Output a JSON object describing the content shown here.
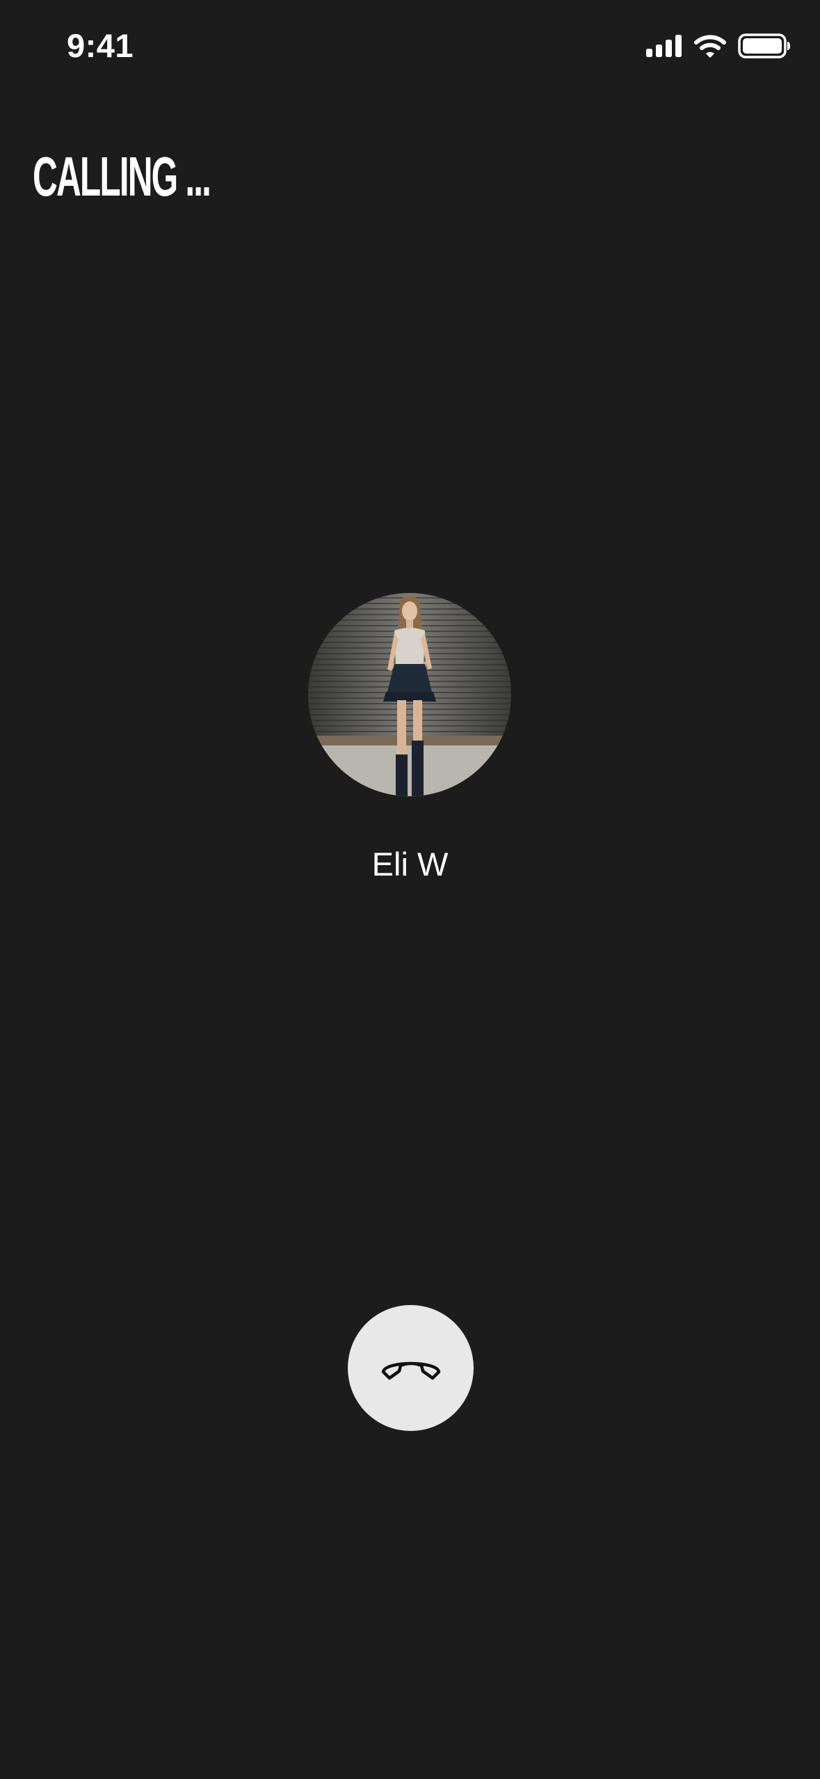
{
  "status_bar": {
    "time": "9:41",
    "icons": [
      "cellular-signal-icon",
      "wifi-icon",
      "battery-icon"
    ]
  },
  "header": {
    "title": "CALLING ..."
  },
  "contact": {
    "name": "Eli W",
    "avatar": "contact-avatar-photo"
  },
  "controls": {
    "end_call_icon": "phone-hangup-icon"
  },
  "colors": {
    "background": "#1c1c1c",
    "text": "#ffffff",
    "end_call_button": "#e8e8e8"
  }
}
